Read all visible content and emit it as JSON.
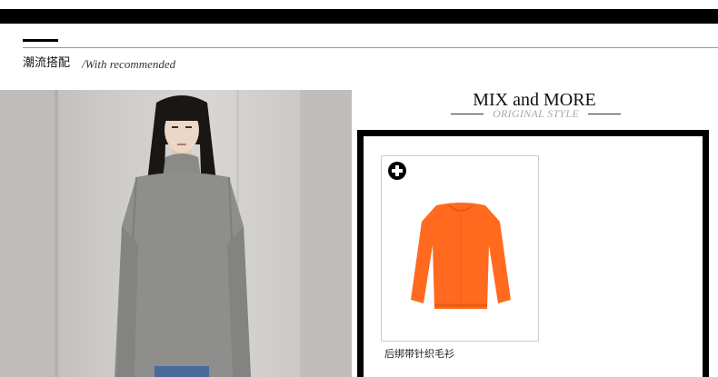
{
  "section": {
    "title": "潮流搭配",
    "subtitle": "/With recommended"
  },
  "mix": {
    "title": "MIX and MORE",
    "tagline": "ORIGINAL STYLE"
  },
  "product": {
    "name": "后绑带针织毛衫",
    "icon": "plus-circle-icon",
    "garment_color": "#ff6a1f"
  },
  "colors": {
    "bar": "#000000",
    "sweater_grey": "#8e8e8e",
    "orange": "#ff6a1f"
  }
}
